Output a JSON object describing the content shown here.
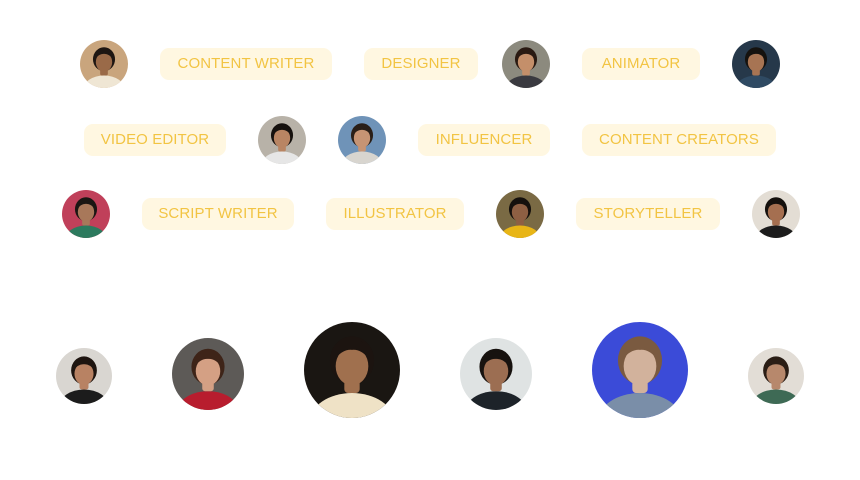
{
  "tags": {
    "content_writer": "CONTENT WRITER",
    "designer": "DESIGNER",
    "animator": "ANIMATOR",
    "video_editor": "VIDEO EDITOR",
    "influencer": "INFLUENCER",
    "content_creators": "CONTENT CREATORS",
    "script_writer": "SCRIPT WRITER",
    "illustrator": "ILLUSTRATOR",
    "storyteller": "STORYTELLER"
  },
  "colors": {
    "tag_background": "#fff7e1",
    "tag_text": "#f2c443",
    "page_background": "#ffffff"
  },
  "avatars": [
    {
      "name": "avatar-man-beard-white-shirt",
      "bg": "#c9a57d",
      "skin": "#9a6a48",
      "hair": "#1e1612",
      "cloth": "#efe6d4"
    },
    {
      "name": "avatar-woman-curly-hair",
      "bg": "#8c8a7e",
      "skin": "#c48f6a",
      "hair": "#2a1a12",
      "cloth": "#3a3a40"
    },
    {
      "name": "avatar-man-denim-jacket",
      "bg": "#26384a",
      "skin": "#a77453",
      "hair": "#15120f",
      "cloth": "#2f4a63"
    },
    {
      "name": "avatar-woman-smile",
      "bg": "#b8b2a8",
      "skin": "#b98563",
      "hair": "#16110e",
      "cloth": "#e6e6e6"
    },
    {
      "name": "avatar-man-blue-background",
      "bg": "#6f93b8",
      "skin": "#c69474",
      "hair": "#2a1f18",
      "cloth": "#d8d5cf"
    },
    {
      "name": "avatar-man-colorful-background",
      "bg": "#c0405a",
      "skin": "#a8785a",
      "hair": "#1b1613",
      "cloth": "#2c7a5e"
    },
    {
      "name": "avatar-woman-yellow-saree",
      "bg": "#7a6a44",
      "skin": "#8e5f43",
      "hair": "#15100d",
      "cloth": "#e8b516"
    },
    {
      "name": "avatar-woman-black-top",
      "bg": "#e3ddd4",
      "skin": "#a56f50",
      "hair": "#14100d",
      "cloth": "#1c1c1c"
    },
    {
      "name": "avatar-woman-black-dress",
      "bg": "#d9d6d1",
      "skin": "#b88263",
      "hair": "#1e1510",
      "cloth": "#1c1c1c"
    },
    {
      "name": "avatar-woman-red-top",
      "bg": "#5d5a57",
      "skin": "#d4a084",
      "hair": "#3e2418",
      "cloth": "#b81d2e"
    },
    {
      "name": "avatar-man-beard-large",
      "bg": "#1a1612",
      "skin": "#a0704e",
      "hair": "#1c1410",
      "cloth": "#efe2c6"
    },
    {
      "name": "avatar-man-suit",
      "bg": "#dfe3e3",
      "skin": "#9c6e52",
      "hair": "#17120f",
      "cloth": "#1d2329"
    },
    {
      "name": "avatar-man-beanie-neon",
      "bg": "#3b4bd8",
      "skin": "#d2b29c",
      "hair": "#7a5a40",
      "cloth": "#7a8ea8"
    },
    {
      "name": "avatar-woman-green-outfit",
      "bg": "#e2ddd6",
      "skin": "#b7886c",
      "hair": "#2a1d15",
      "cloth": "#3e6a55"
    }
  ]
}
